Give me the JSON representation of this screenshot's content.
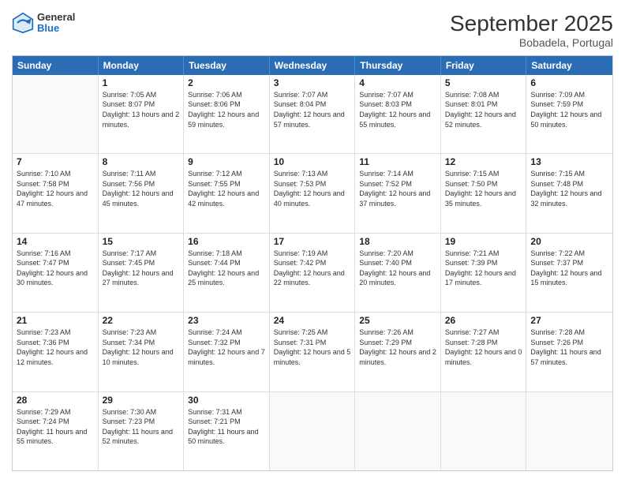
{
  "logo": {
    "line1": "General",
    "line2": "Blue"
  },
  "title": "September 2025",
  "subtitle": "Bobadela, Portugal",
  "header_days": [
    "Sunday",
    "Monday",
    "Tuesday",
    "Wednesday",
    "Thursday",
    "Friday",
    "Saturday"
  ],
  "rows": [
    [
      {
        "day": "",
        "sunrise": "",
        "sunset": "",
        "daylight": ""
      },
      {
        "day": "1",
        "sunrise": "Sunrise: 7:05 AM",
        "sunset": "Sunset: 8:07 PM",
        "daylight": "Daylight: 13 hours and 2 minutes."
      },
      {
        "day": "2",
        "sunrise": "Sunrise: 7:06 AM",
        "sunset": "Sunset: 8:06 PM",
        "daylight": "Daylight: 12 hours and 59 minutes."
      },
      {
        "day": "3",
        "sunrise": "Sunrise: 7:07 AM",
        "sunset": "Sunset: 8:04 PM",
        "daylight": "Daylight: 12 hours and 57 minutes."
      },
      {
        "day": "4",
        "sunrise": "Sunrise: 7:07 AM",
        "sunset": "Sunset: 8:03 PM",
        "daylight": "Daylight: 12 hours and 55 minutes."
      },
      {
        "day": "5",
        "sunrise": "Sunrise: 7:08 AM",
        "sunset": "Sunset: 8:01 PM",
        "daylight": "Daylight: 12 hours and 52 minutes."
      },
      {
        "day": "6",
        "sunrise": "Sunrise: 7:09 AM",
        "sunset": "Sunset: 7:59 PM",
        "daylight": "Daylight: 12 hours and 50 minutes."
      }
    ],
    [
      {
        "day": "7",
        "sunrise": "Sunrise: 7:10 AM",
        "sunset": "Sunset: 7:58 PM",
        "daylight": "Daylight: 12 hours and 47 minutes."
      },
      {
        "day": "8",
        "sunrise": "Sunrise: 7:11 AM",
        "sunset": "Sunset: 7:56 PM",
        "daylight": "Daylight: 12 hours and 45 minutes."
      },
      {
        "day": "9",
        "sunrise": "Sunrise: 7:12 AM",
        "sunset": "Sunset: 7:55 PM",
        "daylight": "Daylight: 12 hours and 42 minutes."
      },
      {
        "day": "10",
        "sunrise": "Sunrise: 7:13 AM",
        "sunset": "Sunset: 7:53 PM",
        "daylight": "Daylight: 12 hours and 40 minutes."
      },
      {
        "day": "11",
        "sunrise": "Sunrise: 7:14 AM",
        "sunset": "Sunset: 7:52 PM",
        "daylight": "Daylight: 12 hours and 37 minutes."
      },
      {
        "day": "12",
        "sunrise": "Sunrise: 7:15 AM",
        "sunset": "Sunset: 7:50 PM",
        "daylight": "Daylight: 12 hours and 35 minutes."
      },
      {
        "day": "13",
        "sunrise": "Sunrise: 7:15 AM",
        "sunset": "Sunset: 7:48 PM",
        "daylight": "Daylight: 12 hours and 32 minutes."
      }
    ],
    [
      {
        "day": "14",
        "sunrise": "Sunrise: 7:16 AM",
        "sunset": "Sunset: 7:47 PM",
        "daylight": "Daylight: 12 hours and 30 minutes."
      },
      {
        "day": "15",
        "sunrise": "Sunrise: 7:17 AM",
        "sunset": "Sunset: 7:45 PM",
        "daylight": "Daylight: 12 hours and 27 minutes."
      },
      {
        "day": "16",
        "sunrise": "Sunrise: 7:18 AM",
        "sunset": "Sunset: 7:44 PM",
        "daylight": "Daylight: 12 hours and 25 minutes."
      },
      {
        "day": "17",
        "sunrise": "Sunrise: 7:19 AM",
        "sunset": "Sunset: 7:42 PM",
        "daylight": "Daylight: 12 hours and 22 minutes."
      },
      {
        "day": "18",
        "sunrise": "Sunrise: 7:20 AM",
        "sunset": "Sunset: 7:40 PM",
        "daylight": "Daylight: 12 hours and 20 minutes."
      },
      {
        "day": "19",
        "sunrise": "Sunrise: 7:21 AM",
        "sunset": "Sunset: 7:39 PM",
        "daylight": "Daylight: 12 hours and 17 minutes."
      },
      {
        "day": "20",
        "sunrise": "Sunrise: 7:22 AM",
        "sunset": "Sunset: 7:37 PM",
        "daylight": "Daylight: 12 hours and 15 minutes."
      }
    ],
    [
      {
        "day": "21",
        "sunrise": "Sunrise: 7:23 AM",
        "sunset": "Sunset: 7:36 PM",
        "daylight": "Daylight: 12 hours and 12 minutes."
      },
      {
        "day": "22",
        "sunrise": "Sunrise: 7:23 AM",
        "sunset": "Sunset: 7:34 PM",
        "daylight": "Daylight: 12 hours and 10 minutes."
      },
      {
        "day": "23",
        "sunrise": "Sunrise: 7:24 AM",
        "sunset": "Sunset: 7:32 PM",
        "daylight": "Daylight: 12 hours and 7 minutes."
      },
      {
        "day": "24",
        "sunrise": "Sunrise: 7:25 AM",
        "sunset": "Sunset: 7:31 PM",
        "daylight": "Daylight: 12 hours and 5 minutes."
      },
      {
        "day": "25",
        "sunrise": "Sunrise: 7:26 AM",
        "sunset": "Sunset: 7:29 PM",
        "daylight": "Daylight: 12 hours and 2 minutes."
      },
      {
        "day": "26",
        "sunrise": "Sunrise: 7:27 AM",
        "sunset": "Sunset: 7:28 PM",
        "daylight": "Daylight: 12 hours and 0 minutes."
      },
      {
        "day": "27",
        "sunrise": "Sunrise: 7:28 AM",
        "sunset": "Sunset: 7:26 PM",
        "daylight": "Daylight: 11 hours and 57 minutes."
      }
    ],
    [
      {
        "day": "28",
        "sunrise": "Sunrise: 7:29 AM",
        "sunset": "Sunset: 7:24 PM",
        "daylight": "Daylight: 11 hours and 55 minutes."
      },
      {
        "day": "29",
        "sunrise": "Sunrise: 7:30 AM",
        "sunset": "Sunset: 7:23 PM",
        "daylight": "Daylight: 11 hours and 52 minutes."
      },
      {
        "day": "30",
        "sunrise": "Sunrise: 7:31 AM",
        "sunset": "Sunset: 7:21 PM",
        "daylight": "Daylight: 11 hours and 50 minutes."
      },
      {
        "day": "",
        "sunrise": "",
        "sunset": "",
        "daylight": ""
      },
      {
        "day": "",
        "sunrise": "",
        "sunset": "",
        "daylight": ""
      },
      {
        "day": "",
        "sunrise": "",
        "sunset": "",
        "daylight": ""
      },
      {
        "day": "",
        "sunrise": "",
        "sunset": "",
        "daylight": ""
      }
    ]
  ]
}
